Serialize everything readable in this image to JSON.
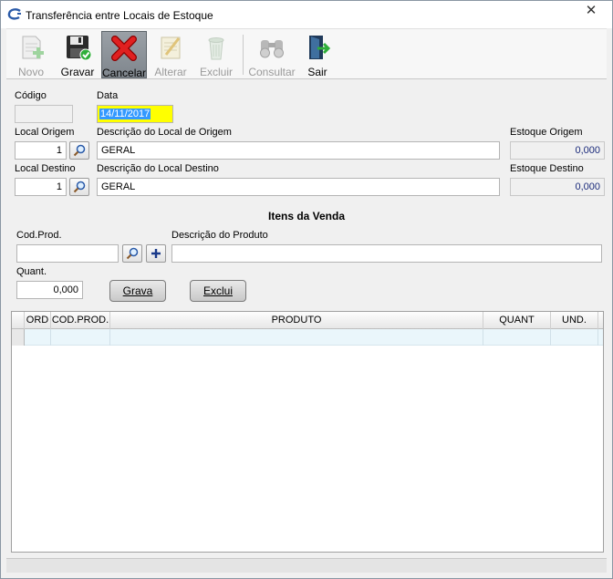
{
  "window": {
    "title": "Transferência entre Locais de Estoque",
    "close_glyph": "✕"
  },
  "toolbar": {
    "novo": "Novo",
    "gravar": "Gravar",
    "cancelar": "Cancelar",
    "alterar": "Alterar",
    "excluir": "Excluir",
    "consultar": "Consultar",
    "sair": "Sair"
  },
  "form": {
    "codigo_label": "Código",
    "codigo_value": "",
    "data_label": "Data",
    "data_value": "14/11/2017",
    "local_origem_label": "Local Origem",
    "local_origem_value": "1",
    "desc_origem_label": "Descrição do Local de Origem",
    "desc_origem_value": "GERAL",
    "estoque_origem_label": "Estoque Origem",
    "estoque_origem_value": "0,000",
    "local_destino_label": "Local Destino",
    "local_destino_value": "1",
    "desc_destino_label": "Descrição do Local Destino",
    "desc_destino_value": "GERAL",
    "estoque_destino_label": "Estoque Destino",
    "estoque_destino_value": "0,000"
  },
  "items": {
    "section_title": "Itens da Venda",
    "cod_prod_label": "Cod.Prod.",
    "cod_prod_value": "",
    "desc_prod_label": "Descrição do Produto",
    "desc_prod_value": "",
    "quant_label": "Quant.",
    "quant_value": "0,000",
    "grava_label": "Grava",
    "exclui_label": "Exclui"
  },
  "grid": {
    "columns": [
      "ORD",
      "COD.PROD.",
      "PRODUTO",
      "QUANT",
      "UND."
    ]
  },
  "colors": {
    "date_highlight": "#ffff00",
    "selection": "#3399ff",
    "row_tint": "#eaf6fb"
  }
}
